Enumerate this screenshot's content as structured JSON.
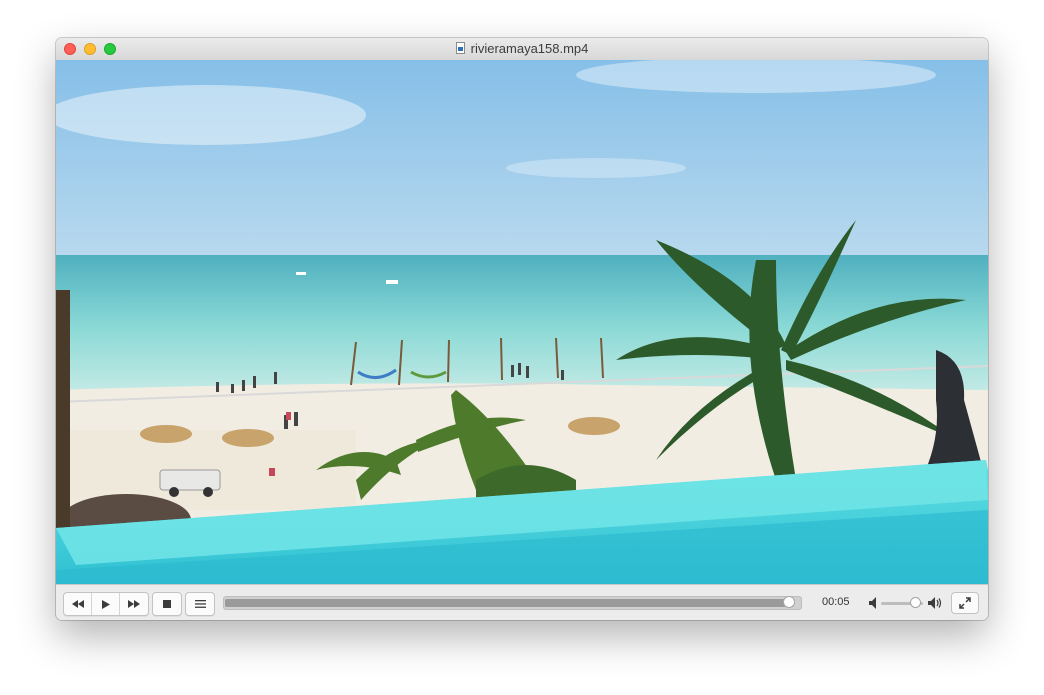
{
  "window": {
    "title": "rivieramaya158.mp4"
  },
  "icons": {
    "close": "close-button",
    "minimize": "minimize-button",
    "zoom": "zoom-button",
    "file": "video-file-icon",
    "rewind": "rewind-icon",
    "play": "play-icon",
    "forward": "fast-forward-icon",
    "stop": "stop-icon",
    "playlist": "playlist-icon",
    "volume_low": "speaker-low-icon",
    "volume_high": "speaker-high-icon",
    "fullscreen": "fullscreen-icon"
  },
  "playback": {
    "elapsed": "00:05",
    "progress_fraction": 0.99,
    "volume_fraction": 0.8
  },
  "colors": {
    "close": "#ff5f57",
    "minimize": "#febc2e",
    "zoom": "#28c840",
    "pool": "#52d3d8",
    "sea": "#8ad9d6"
  }
}
